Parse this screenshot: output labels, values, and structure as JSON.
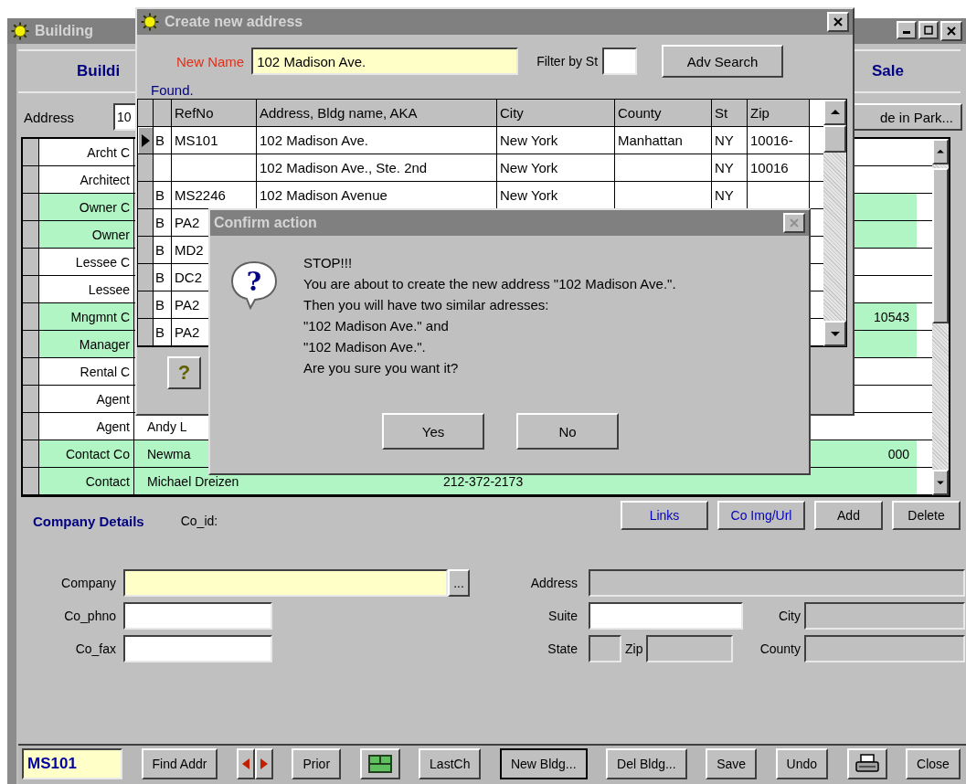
{
  "building_window": {
    "title": "Building",
    "header": {
      "left": "Buildi",
      "right": "Sale"
    },
    "address": {
      "label": "Address",
      "value": "10",
      "button": "de in Park..."
    },
    "contacts": [
      {
        "label": "Archt C",
        "highlighted": false
      },
      {
        "label": "Architect",
        "highlighted": false
      },
      {
        "label": "Owner C",
        "highlighted": true
      },
      {
        "label": "Owner",
        "highlighted": true
      },
      {
        "label": "Lessee C",
        "highlighted": false
      },
      {
        "label": "Lessee",
        "highlighted": false
      },
      {
        "label": "Mngmnt C",
        "column_4": "10543",
        "highlighted": true
      },
      {
        "label": "Manager",
        "highlighted": true
      },
      {
        "label": "Rental C",
        "highlighted": false
      },
      {
        "label": "Agent",
        "highlighted": false
      },
      {
        "label": "Agent",
        "name": "Andy L",
        "highlighted": false
      },
      {
        "label": "Contact Co",
        "name": "Newma",
        "column_4": "000",
        "highlighted": true
      },
      {
        "label": "Contact",
        "name": "Michael Dreizen",
        "phone": "212-372-2173",
        "highlighted": true
      }
    ],
    "company_details": {
      "title": "Company Details",
      "co_id_label": "Co_id:",
      "buttons": [
        {
          "label": "Links",
          "kind": "link"
        },
        {
          "label": "Co Img/Url",
          "kind": "link"
        },
        {
          "label": "Add",
          "kind": "plain"
        },
        {
          "label": "Delete",
          "kind": "plain"
        }
      ],
      "left_fields": [
        {
          "label": "Company",
          "kind": "lookup",
          "lookup_button": "..."
        },
        {
          "label": "Co_phno",
          "kind": "text"
        },
        {
          "label": "Co_fax",
          "kind": "text"
        }
      ],
      "right_rows": [
        [
          {
            "label": "Address",
            "kind": "readonly"
          }
        ],
        [
          {
            "label": "Suite",
            "kind": "text"
          },
          {
            "label": "City",
            "kind": "readonly"
          }
        ],
        [
          {
            "label": "State",
            "kind": "readonly"
          },
          {
            "label": "Zip",
            "kind": "readonly"
          },
          {
            "label": "County",
            "kind": "readonly"
          }
        ]
      ]
    },
    "toolbar": [
      {
        "kind": "field",
        "text": "MS101"
      },
      {
        "kind": "button",
        "label": "Find Addr",
        "default": false
      },
      {
        "kind": "arrows"
      },
      {
        "kind": "button",
        "label": "Prior",
        "default": false
      },
      {
        "kind": "grid"
      },
      {
        "kind": "button",
        "label": "LastCh",
        "default": false
      },
      {
        "kind": "button",
        "label": "New Bldg...",
        "default": true
      },
      {
        "kind": "button",
        "label": "Del Bldg...",
        "default": false
      },
      {
        "kind": "button",
        "label": "Save",
        "default": false
      },
      {
        "kind": "button",
        "label": "Undo",
        "default": false
      },
      {
        "kind": "print"
      },
      {
        "kind": "button",
        "label": "Close",
        "default": false
      }
    ]
  },
  "create_dialog": {
    "title": "Create new address",
    "new_name_label": "New Name",
    "new_name_value": "102 Madison Ave.",
    "filter_label": "Filter by St",
    "search_button": "Adv Search",
    "found_label": "Found.",
    "columns": [
      "RefNo",
      "Address, Bldg name, AKA",
      "City",
      "County",
      "St",
      "Zip"
    ],
    "rows": [
      {
        "current": true,
        "flag": "B",
        "cells": [
          "MS101",
          "102 Madison Ave.",
          "New York",
          "Manhattan",
          "NY",
          "10016-"
        ]
      },
      {
        "current": false,
        "cells": [
          null,
          "102 Madison Ave., Ste. 2nd",
          "New York",
          null,
          "NY",
          "10016"
        ]
      },
      {
        "current": false,
        "flag": "B",
        "cells": [
          "MS2246",
          "102 Madison Avenue",
          "New York",
          null,
          "NY"
        ]
      },
      {
        "current": false,
        "flag": "B",
        "cells": [
          "PA2"
        ]
      },
      {
        "current": false,
        "flag": "B",
        "cells": [
          "MD2"
        ]
      },
      {
        "current": false,
        "flag": "B",
        "cells": [
          "DC2"
        ]
      },
      {
        "current": false,
        "flag": "B",
        "cells": [
          "PA2"
        ]
      },
      {
        "current": false,
        "flag": "B",
        "cells": [
          "PA2"
        ]
      }
    ],
    "help_button": "?"
  },
  "confirm_dialog": {
    "title": "Confirm action",
    "icon_glyph": "?",
    "message": [
      "STOP!!!",
      "You are about to create the new address \"102 Madison Ave.\".",
      "Then you will have two similar adresses:",
      "\"102 Madison Ave.\" and",
      "\"102 Madison Ave.\".",
      "Are you sure you want it?"
    ],
    "buttons": [
      "Yes",
      "No"
    ]
  }
}
